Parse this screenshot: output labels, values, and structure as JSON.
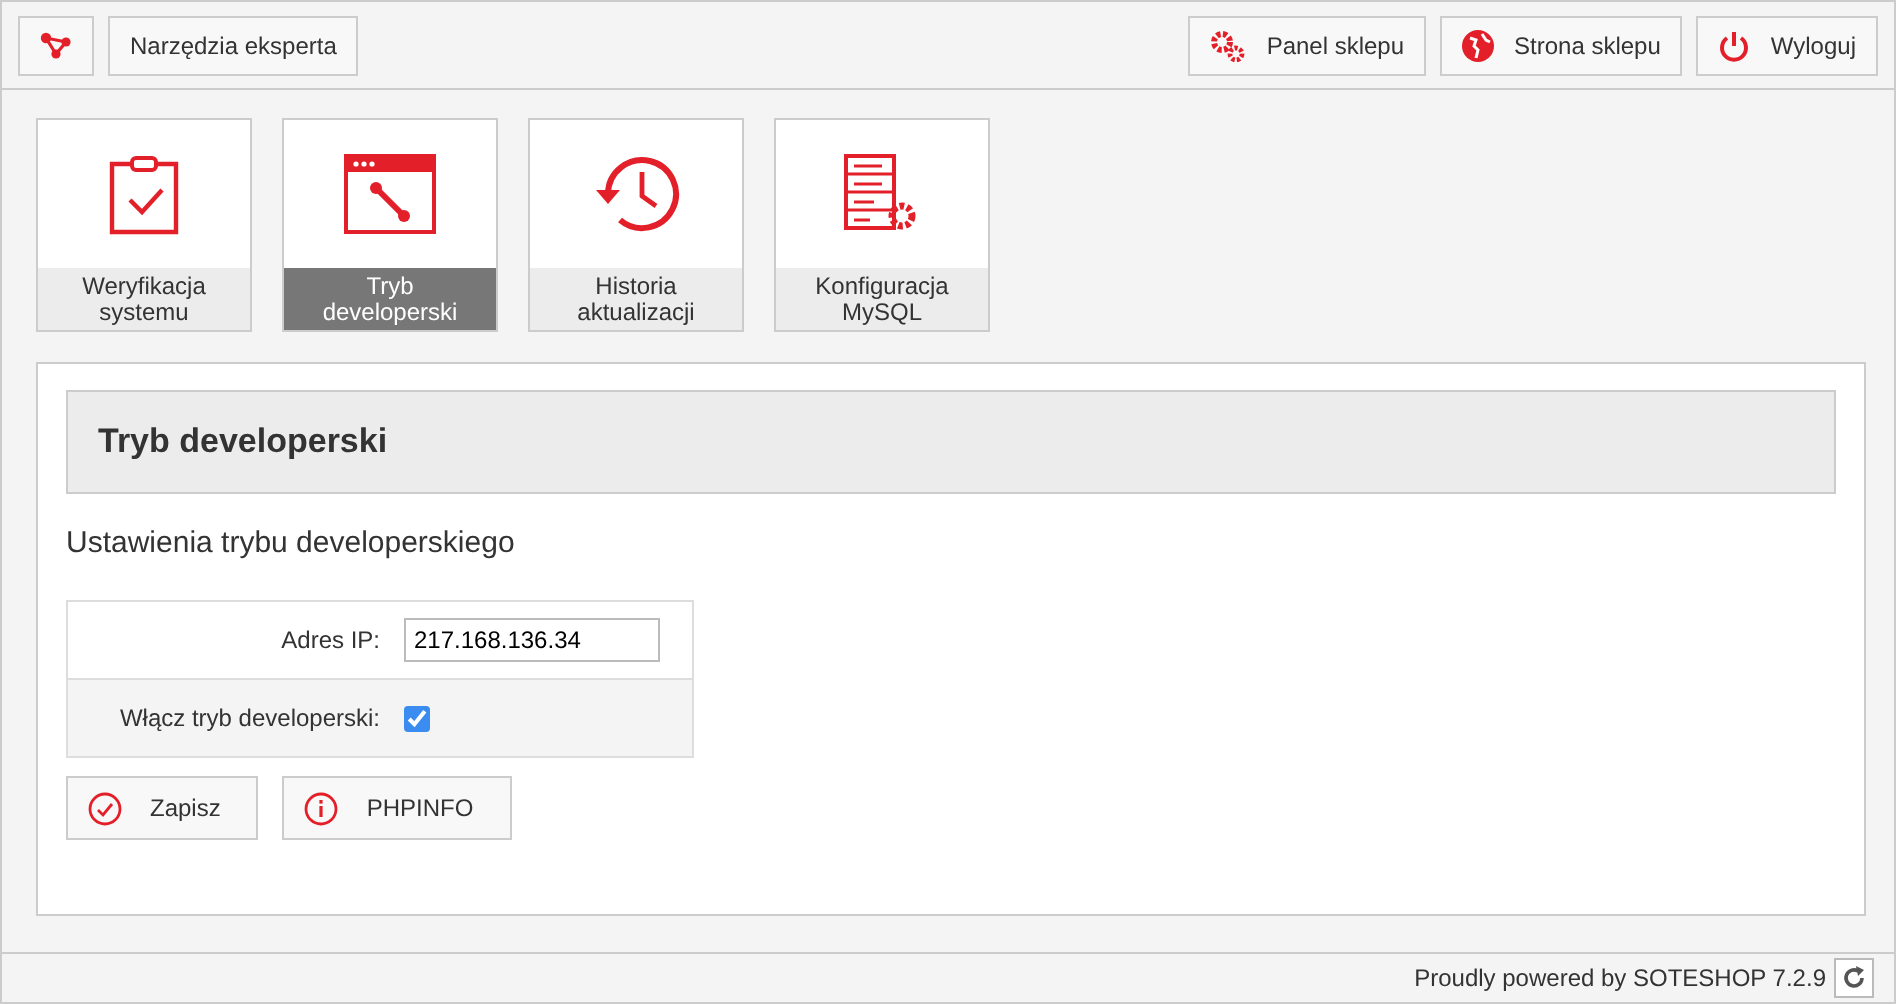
{
  "topbar": {
    "title": "Narzędzia eksperta",
    "actions": [
      {
        "kind": "gears",
        "label": "Panel sklepu"
      },
      {
        "kind": "globe",
        "label": "Strona sklepu"
      },
      {
        "kind": "power",
        "label": "Wyloguj"
      }
    ]
  },
  "tiles": [
    {
      "kind": "clipboard",
      "label": "Weryfikacja systemu",
      "selected": false
    },
    {
      "kind": "window",
      "label": "Tryb developerski",
      "selected": true
    },
    {
      "kind": "history",
      "label": "Historia aktualizacji",
      "selected": false
    },
    {
      "kind": "database",
      "label": "Konfiguracja MySQL",
      "selected": false
    }
  ],
  "panel": {
    "heading": "Tryb developerski",
    "subheading": "Ustawienia trybu developerskiego",
    "ip_label": "Adres IP:",
    "ip_value": "217.168.136.34",
    "dev_label": "Włącz tryb developerski:",
    "dev_checked": true,
    "buttons": [
      {
        "kind": "check",
        "label": "Zapisz"
      },
      {
        "kind": "info",
        "label": "PHPINFO"
      }
    ]
  },
  "footer": {
    "text": "Proudly powered by SOTESHOP 7.2.9"
  }
}
